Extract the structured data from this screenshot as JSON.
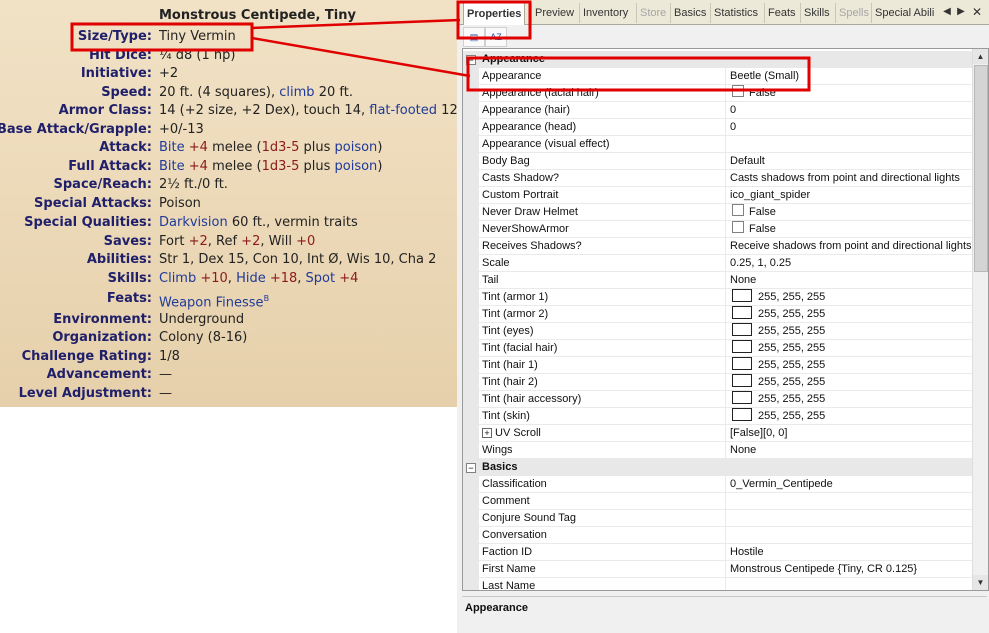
{
  "stat": {
    "title": "Monstrous Centipede, Tiny",
    "size_type": {
      "label": "Size/Type:",
      "value": "Tiny Vermin"
    },
    "hit_dice": {
      "label": "Hit Dice:",
      "value": "¼ d8 (1 hp)"
    },
    "initiative": {
      "label": "Initiative:",
      "value": "+2"
    },
    "speed": {
      "label": "Speed:",
      "pre": "20 ft. (4 squares),",
      "link": "climb",
      "post": "20 ft."
    },
    "armor": {
      "label": "Armor Class:",
      "pre": "14 (+2 size, +2 Dex), touch 14,",
      "link": "flat-footed",
      "post": "12"
    },
    "bab": {
      "label": "Base Attack/Grapple:",
      "value": "+0/-13"
    },
    "attack": {
      "label": "Attack:",
      "link1": "Bite",
      "n1": "+4",
      "mid": "melee (",
      "n2": "1d3-5",
      "plus": "plus",
      "link2": "poison",
      "end": ")"
    },
    "full_attack": {
      "label": "Full Attack:",
      "link1": "Bite",
      "n1": "+4",
      "mid": "melee (",
      "n2": "1d3-5",
      "plus": "plus",
      "link2": "poison",
      "end": ")"
    },
    "space": {
      "label": "Space/Reach:",
      "value": "2½ ft./0 ft."
    },
    "special_attacks": {
      "label": "Special Attacks:",
      "value": "Poison"
    },
    "special_qualities": {
      "label": "Special Qualities:",
      "link": "Darkvision",
      "post": "60 ft., vermin traits"
    },
    "saves": {
      "label": "Saves:",
      "a": "Fort",
      "an": "+2",
      "b": ", Ref",
      "bn": "+2",
      "c": ", Will",
      "cn": "+0"
    },
    "abilities": {
      "label": "Abilities:",
      "value": "Str 1, Dex 15, Con 10, Int Ø, Wis 10, Cha 2"
    },
    "skills": {
      "label": "Skills:",
      "s1": "Climb",
      "s1n": "+10",
      "s2": "Hide",
      "s2n": "+18",
      "s3": "Spot",
      "s3n": "+4"
    },
    "feats": {
      "label": "Feats:",
      "value": "Weapon Finesse",
      "sup": "B"
    },
    "environment": {
      "label": "Environment:",
      "value": "Underground"
    },
    "organization": {
      "label": "Organization:",
      "value": "Colony (8-16)"
    },
    "cr": {
      "label": "Challenge Rating:",
      "value": "1/8"
    },
    "advancement": {
      "label": "Advancement:",
      "value": "—"
    },
    "level_adj": {
      "label": "Level Adjustment:",
      "value": "—"
    }
  },
  "tabs": [
    "Properties",
    "Preview",
    "Inventory",
    "Store",
    "Basics",
    "Statistics",
    "Feats",
    "Skills",
    "Spells",
    "Special Abili"
  ],
  "grid": {
    "cat_appearance": "Appearance",
    "cat_basics": "Basics",
    "rows": [
      {
        "name": "Appearance",
        "value": "Beetle (Small)"
      },
      {
        "name": "Appearance (facial hair)",
        "value": "False"
      },
      {
        "name": "Appearance (hair)",
        "value": "0"
      },
      {
        "name": "Appearance (head)",
        "value": "0"
      },
      {
        "name": "Appearance (visual effect)",
        "value": ""
      },
      {
        "name": "Body Bag",
        "value": "Default"
      },
      {
        "name": "Casts Shadow?",
        "value": "Casts shadows from point and directional lights"
      },
      {
        "name": "Custom Portrait",
        "value": "ico_giant_spider"
      },
      {
        "name": "Never Draw Helmet",
        "value": "False"
      },
      {
        "name": "NeverShowArmor",
        "value": "False"
      },
      {
        "name": "Receives Shadows?",
        "value": "Receive shadows from point and directional lights"
      },
      {
        "name": "Scale",
        "value": "0.25, 1, 0.25"
      },
      {
        "name": "Tail",
        "value": "None"
      },
      {
        "name": "Tint (armor 1)",
        "value": "255, 255, 255"
      },
      {
        "name": "Tint (armor 2)",
        "value": "255, 255, 255"
      },
      {
        "name": "Tint (eyes)",
        "value": "255, 255, 255"
      },
      {
        "name": "Tint (facial hair)",
        "value": "255, 255, 255"
      },
      {
        "name": "Tint (hair 1)",
        "value": "255, 255, 255"
      },
      {
        "name": "Tint (hair 2)",
        "value": "255, 255, 255"
      },
      {
        "name": "Tint (hair accessory)",
        "value": "255, 255, 255"
      },
      {
        "name": "Tint (skin)",
        "value": "255, 255, 255"
      },
      {
        "name": "UV Scroll",
        "value": "[False][0, 0]"
      },
      {
        "name": "Wings",
        "value": "None"
      },
      {
        "name": "Classification",
        "value": "0_Vermin_Centipede"
      },
      {
        "name": "Comment",
        "value": ""
      },
      {
        "name": "Conjure Sound Tag",
        "value": ""
      },
      {
        "name": "Conversation",
        "value": ""
      },
      {
        "name": "Faction ID",
        "value": "Hostile"
      },
      {
        "name": "First Name",
        "value": "Monstrous Centipede {Tiny, CR 0.125}"
      },
      {
        "name": "Last Name",
        "value": ""
      }
    ]
  },
  "description_title": "Appearance",
  "colors": {
    "highlight_red": "#e00000",
    "tab_active_bg": "#ffffff",
    "parchment": "#ecd9b8"
  }
}
